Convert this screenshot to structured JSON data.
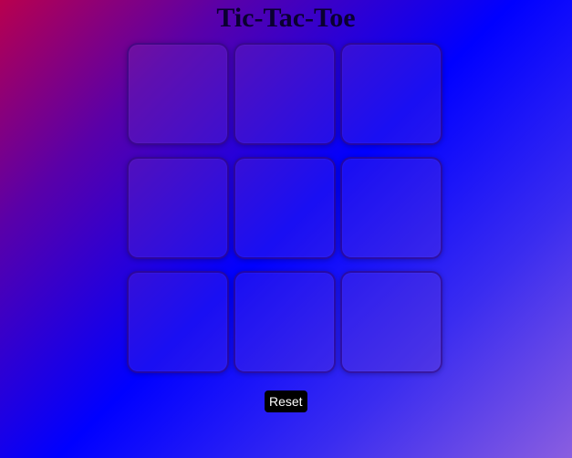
{
  "title": "Tic-Tac-Toe",
  "board": {
    "cells": [
      "",
      "",
      "",
      "",
      "",
      "",
      "",
      "",
      ""
    ]
  },
  "controls": {
    "reset_label": "Reset"
  },
  "colors": {
    "background_start": "#b8004e",
    "background_mid": "#0000ff",
    "background_end": "#8a5ee0",
    "reset_button_bg": "#000000",
    "reset_button_text": "#ffffff"
  }
}
